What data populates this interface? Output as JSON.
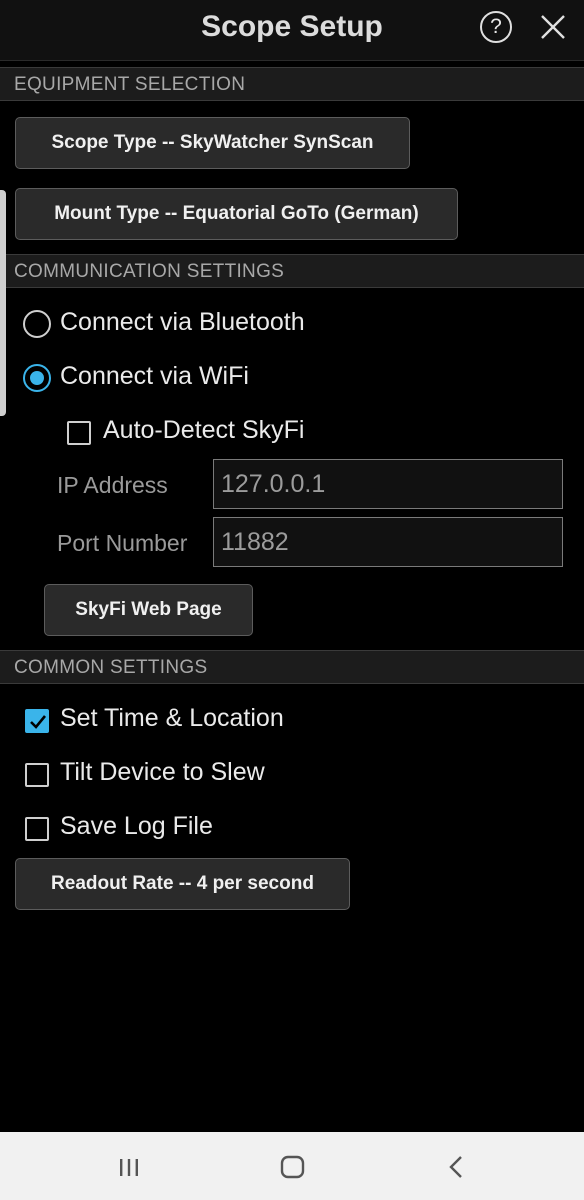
{
  "header": {
    "title": "Scope Setup",
    "help_icon": "help-circle-icon",
    "help_label": "?",
    "close_icon": "close-icon"
  },
  "sections": {
    "equipment": "EQUIPMENT SELECTION",
    "communication": "COMMUNICATION SETTINGS",
    "common": "COMMON SETTINGS"
  },
  "equipment": {
    "scope_type_label": "Scope Type -- SkyWatcher SynScan",
    "mount_type_label": "Mount Type -- Equatorial GoTo (German)"
  },
  "communication": {
    "bluetooth_label": "Connect via Bluetooth",
    "bluetooth_selected": false,
    "wifi_label": "Connect via WiFi",
    "wifi_selected": true,
    "auto_detect_label": "Auto-Detect SkyFi",
    "auto_detect_checked": false,
    "ip_label": "IP Address",
    "ip_value": "127.0.0.1",
    "port_label": "Port Number",
    "port_value": "11882",
    "skyfi_button_label": "SkyFi Web Page"
  },
  "common": {
    "set_time_label": "Set Time & Location",
    "set_time_checked": true,
    "tilt_label": "Tilt Device to Slew",
    "tilt_checked": false,
    "save_log_label": "Save Log File",
    "save_log_checked": false,
    "readout_rate_label": "Readout Rate -- 4 per second"
  },
  "navbar": {
    "recents_icon": "recent-apps-icon",
    "home_icon": "home-icon",
    "back_icon": "back-icon"
  },
  "colors": {
    "accent": "#3ab4ea",
    "background": "#000000",
    "section_bg": "#1c1c1c",
    "button_bg": "#2a2a2a",
    "navbar_bg": "#f1f1f1"
  }
}
